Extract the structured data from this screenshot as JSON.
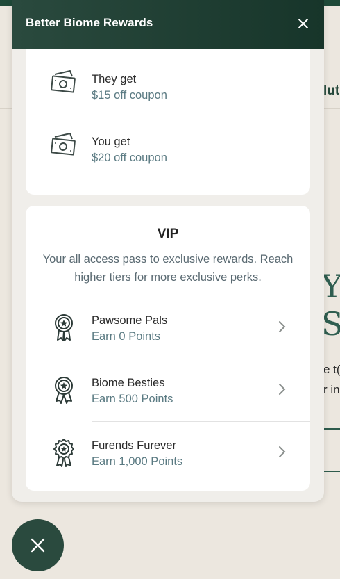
{
  "background": {
    "nav_fragment": "lut",
    "heading_fragment_1": "Y(",
    "heading_fragment_2": "S",
    "body_fragment_1": "e t(",
    "body_fragment_2": "r in"
  },
  "widget": {
    "title": "Better Biome Rewards",
    "close_icon": "close-icon"
  },
  "referral": {
    "items": [
      {
        "label": "They get",
        "value": "$15 off coupon",
        "icon": "cash-icon"
      },
      {
        "label": "You get",
        "value": "$20 off coupon",
        "icon": "cash-icon"
      }
    ]
  },
  "vip": {
    "title": "VIP",
    "description": "Your all access pass to exclusive rewards. Reach higher tiers for more exclusive perks.",
    "tiers": [
      {
        "name": "Pawsome Pals",
        "points": "Earn 0 Points",
        "icon": "award-ribbon-icon"
      },
      {
        "name": "Biome Besties",
        "points": "Earn 500 Points",
        "icon": "award-ribbon-icon"
      },
      {
        "name": "Furends Furever",
        "points": "Earn 1,000 Points",
        "icon": "award-seal-icon"
      }
    ]
  },
  "launcher": {
    "icon": "close-icon"
  },
  "colors": {
    "brand_dark_green": "#1f4a39",
    "header_gradient_start": "#2a4a3e",
    "secondary_text": "#5a7a82",
    "page_background": "#ece7df"
  }
}
